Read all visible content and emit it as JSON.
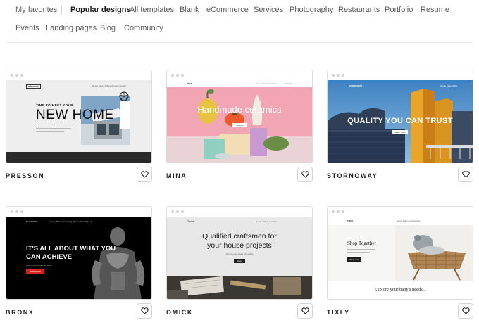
{
  "nav": {
    "favorites": "My favorites",
    "tabs": [
      "Popular designs",
      "All templates",
      "Blank",
      "eCommerce",
      "Services",
      "Photography",
      "Restaurants",
      "Portfolio",
      "Resume",
      "Events",
      "Landing pages",
      "Blog",
      "Community"
    ],
    "active_tab": "Popular designs"
  },
  "templates": [
    {
      "name": "PRESSON",
      "preview": {
        "logo": "PRESSON",
        "nav": "Home   Pages ▾   Blog   Photos   Contact",
        "kicker": "TIME TO MEET YOUR",
        "headline": "NEW HOME"
      }
    },
    {
      "name": "MINA",
      "preview": {
        "logo": "MINA",
        "nav": "Home   About ▾   Contact",
        "cart": "Cart (0)",
        "headline": "Handmade ceramics",
        "button": "Shop all"
      }
    },
    {
      "name": "STORNOWAY",
      "preview": {
        "logo": "STORNOWAY",
        "nav": "Home   Pages   Blog",
        "headline": "QUALITY YOU CAN TRUST",
        "button": "Learn more"
      }
    },
    {
      "name": "BRONX",
      "preview": {
        "logo": "Bronx Club",
        "nav": "Home   Personal training   Prices   About   Sign up",
        "headline_line1": "IT'S ALL ABOUT WHAT YOU",
        "headline_line2": "CAN ACHIEVE",
        "subtext": "Lorem ipsum dolor sit amet",
        "button": "JOIN NOW"
      }
    },
    {
      "name": "OMICK",
      "preview": {
        "logo": "Omick",
        "nav": "Home   Gallery   Contact",
        "headline_line1": "Qualified craftsmen for",
        "headline_line2": "your house projects",
        "subtext": "Turning your ideas into reality",
        "button": "About"
      }
    },
    {
      "name": "TIXLY",
      "preview": {
        "logo": "TIXLY",
        "nav": "Home   Shop   Contact   Cart",
        "headline": "Shop Together",
        "button": "Shop now",
        "section_title": "Explore your baby's needs..."
      }
    }
  ],
  "colors": {
    "nav_active": "#1a1a1a",
    "nav_inactive": "#5b5b5b",
    "mina_bg": "#f2a6b4",
    "bronx_button": "#d9231c",
    "stornoway_sky": "#4f8fc9"
  },
  "icons": {
    "favorite": "heart-outline-icon"
  }
}
